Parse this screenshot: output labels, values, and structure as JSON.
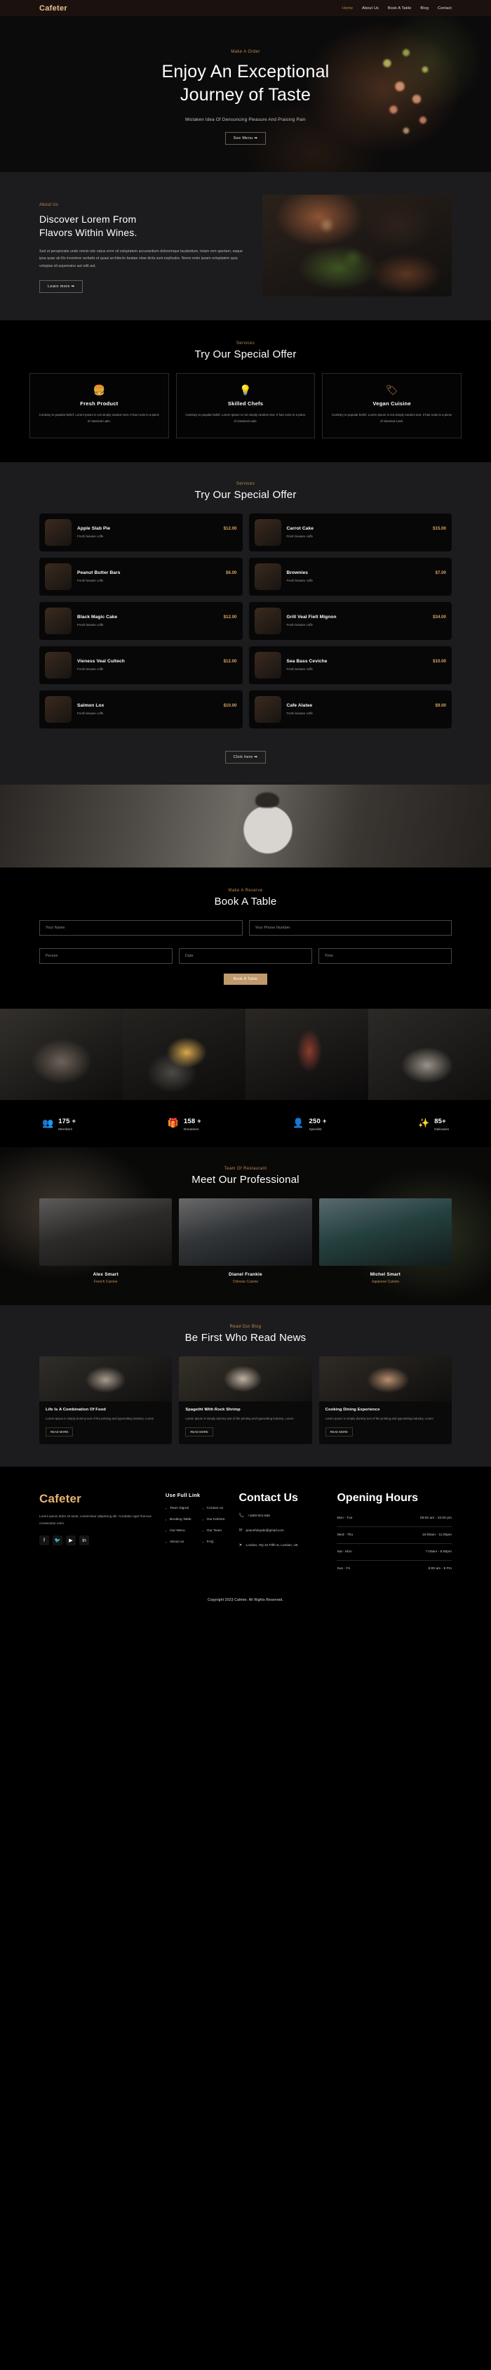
{
  "brand": "Cafeter",
  "nav": {
    "items": [
      {
        "label": "Home",
        "active": true
      },
      {
        "label": "About Us",
        "active": false
      },
      {
        "label": "Book A Table",
        "active": false
      },
      {
        "label": "Blog",
        "active": false
      },
      {
        "label": "Contact",
        "active": false
      }
    ]
  },
  "hero": {
    "eyebrow": "Make A Order",
    "title_line1": "Enjoy An Exceptional",
    "title_line2": "Journey of Taste",
    "subtitle": "Mistaken Idea Of Denouncing Pleasure And Praising Pain",
    "cta": "See Menu ➡"
  },
  "about": {
    "label": "About Us",
    "title_line1": "Discover Lorem From",
    "title_line2": "Flavors Within Wines.",
    "body": "Sed ut perspiciatis unde omnis iste natus error sit voluptatem accusantium doloremque laudantium, totam rem aperiam, eaque ipsa quae ab illo inventore veritatis et quasi architecto beatae vitae dicta sunt explicabo. Nemo enim ipsam voluptatem quia voluptas sit aspernatur aut odit aut.",
    "cta": "Learn more ➡"
  },
  "services": {
    "label": "Services",
    "title": "Try Our Special Offer",
    "cards": [
      {
        "icon": "burger-icon",
        "glyph": "🍔",
        "title": "Fresh Product",
        "text": "Contrary to popular belief, Lorem Ipsum is not simply random text. It has roots in a piece of classical Latin."
      },
      {
        "icon": "lightbulb-icon",
        "glyph": "💡",
        "title": "Skilled Chefs",
        "text": "Contrary to popular belief, Lorem Ipsum is not simply random text. It has roots in a piece of classical Latin."
      },
      {
        "icon": "tag-icon",
        "glyph": "🏷",
        "title": "Vegan Cuisine",
        "text": "Contrary to popular belief, Lorem Ipsum is not simply random text. It has roots in a piece of classical Latin."
      }
    ]
  },
  "menu": {
    "label": "Services",
    "title": "Try Our Special Offer",
    "items": [
      {
        "name": "Apple Slab Pie",
        "price": "$12.00",
        "desc": "Fresh beware coffe"
      },
      {
        "name": "Carrot Cake",
        "price": "$15.00",
        "desc": "Fresh beware coffe"
      },
      {
        "name": "Peanut Butter Bars",
        "price": "$6.00",
        "desc": "Fresh beware coffe"
      },
      {
        "name": "Brownies",
        "price": "$7.00",
        "desc": "Fresh beware coffe"
      },
      {
        "name": "Black Magic Cake",
        "price": "$12.00",
        "desc": "Fresh beware coffe"
      },
      {
        "name": "Grill Veal Fielt Mignon",
        "price": "$34.00",
        "desc": "Fresh beware coffe"
      },
      {
        "name": "Vieness Veal Cultech",
        "price": "$12.00",
        "desc": "Fresh beware coffe"
      },
      {
        "name": "Sea Bass Ceviche",
        "price": "$10.00",
        "desc": "Fresh beware coffe"
      },
      {
        "name": "Salmon Lox",
        "price": "$10.00",
        "desc": "Fresh beware coffe"
      },
      {
        "name": "Cafe Alatee",
        "price": "$9.00",
        "desc": "Fresh beware coffe"
      }
    ],
    "cta": "Click here ➡"
  },
  "book": {
    "label": "Make A Reserve",
    "title": "Book A Table",
    "fields": {
      "name": "Your Name",
      "phone": "Your Phone Number",
      "person": "Person",
      "date": "Date",
      "time": "Time"
    },
    "cta": "Book A Table"
  },
  "stats": [
    {
      "icon": "members-icon",
      "glyph": "👥",
      "value": "175 +",
      "label": "Members"
    },
    {
      "icon": "donations-icon",
      "glyph": "🎁",
      "value": "158 +",
      "label": "Donations"
    },
    {
      "icon": "specialist-icon",
      "glyph": "👤",
      "value": "250 +",
      "label": "Specilist"
    },
    {
      "icon": "delicious-icon",
      "glyph": "✨",
      "value": "85+",
      "label": "Dalicases"
    }
  ],
  "team": {
    "label": "Team Of Restaurant",
    "title": "Meet Our Professional",
    "members": [
      {
        "name": "Alex Smart",
        "role": "French Cuisine"
      },
      {
        "name": "Dianel Frankie",
        "role": "Chinese Cuisine"
      },
      {
        "name": "Michel Smart",
        "role": "Japanese Cuisine"
      }
    ]
  },
  "blog": {
    "label": "Read Our Blog",
    "title": "Be First Who Read News",
    "posts": [
      {
        "title": "Life Is A Combination Of Food",
        "text": "Lorem Ipsum is simply dummy text of the printing and typesetting industry. Lorem",
        "more": "READ MORE"
      },
      {
        "title": "Spagethi With Rock Shrimp",
        "text": "Lorem Ipsum is simply dummy text of the printing and typesetting industry. Lorem",
        "more": "READ MORE"
      },
      {
        "title": "Cooking Dining Experience",
        "text": "Lorem Ipsum is simply dummy text of the printing and typesetting industry. Lorem",
        "more": "READ MORE"
      }
    ]
  },
  "footer": {
    "logo": "Cafeter",
    "about": "Lorem ipsum dolor sit amet, consectetur adipiscing elit. Curabitur eget rhoncus consectetur enim.",
    "social": [
      {
        "name": "facebook-icon",
        "glyph": "f"
      },
      {
        "name": "twitter-icon",
        "glyph": "🐦"
      },
      {
        "name": "youtube-icon",
        "glyph": "▶"
      },
      {
        "name": "linkedin-icon",
        "glyph": "in"
      }
    ],
    "links_title": "Use Full Link",
    "links_col1": [
      "Team Signal",
      "Booking Table",
      "Our Menu",
      "About Us"
    ],
    "links_col2": [
      "Contact us",
      "Our Kitchen",
      "Our Team",
      "FAQ"
    ],
    "contact_title": "Contact Us",
    "contact": [
      {
        "icon": "phone-icon",
        "glyph": "📞",
        "value": "+1800-001-658"
      },
      {
        "icon": "mail-icon",
        "glyph": "✉",
        "value": "peacefulqode@gmail.com"
      },
      {
        "icon": "location-icon",
        "glyph": "➤",
        "value": "London, HQ 24 Fifth st, London, UK"
      }
    ],
    "hours_title": "Opening Hours",
    "hours": [
      {
        "days": "Mon - Tue",
        "time": "09:00 am - 10:00 pm"
      },
      {
        "days": "Wed - Thu",
        "time": "10:00am - 11:00pm"
      },
      {
        "days": "Sat - Mon",
        "time": "7:00am - 8:00pm"
      },
      {
        "days": "Sun - Fri",
        "time": "9:00 am - 8 Pm"
      }
    ],
    "copyright": "Copyright 2023 Cafeter. All Rights Reserved."
  },
  "colors": {
    "accent": "#c08b52",
    "gold": "#e8b46f",
    "dark": "#000000",
    "panel": "#1c1c1e"
  }
}
